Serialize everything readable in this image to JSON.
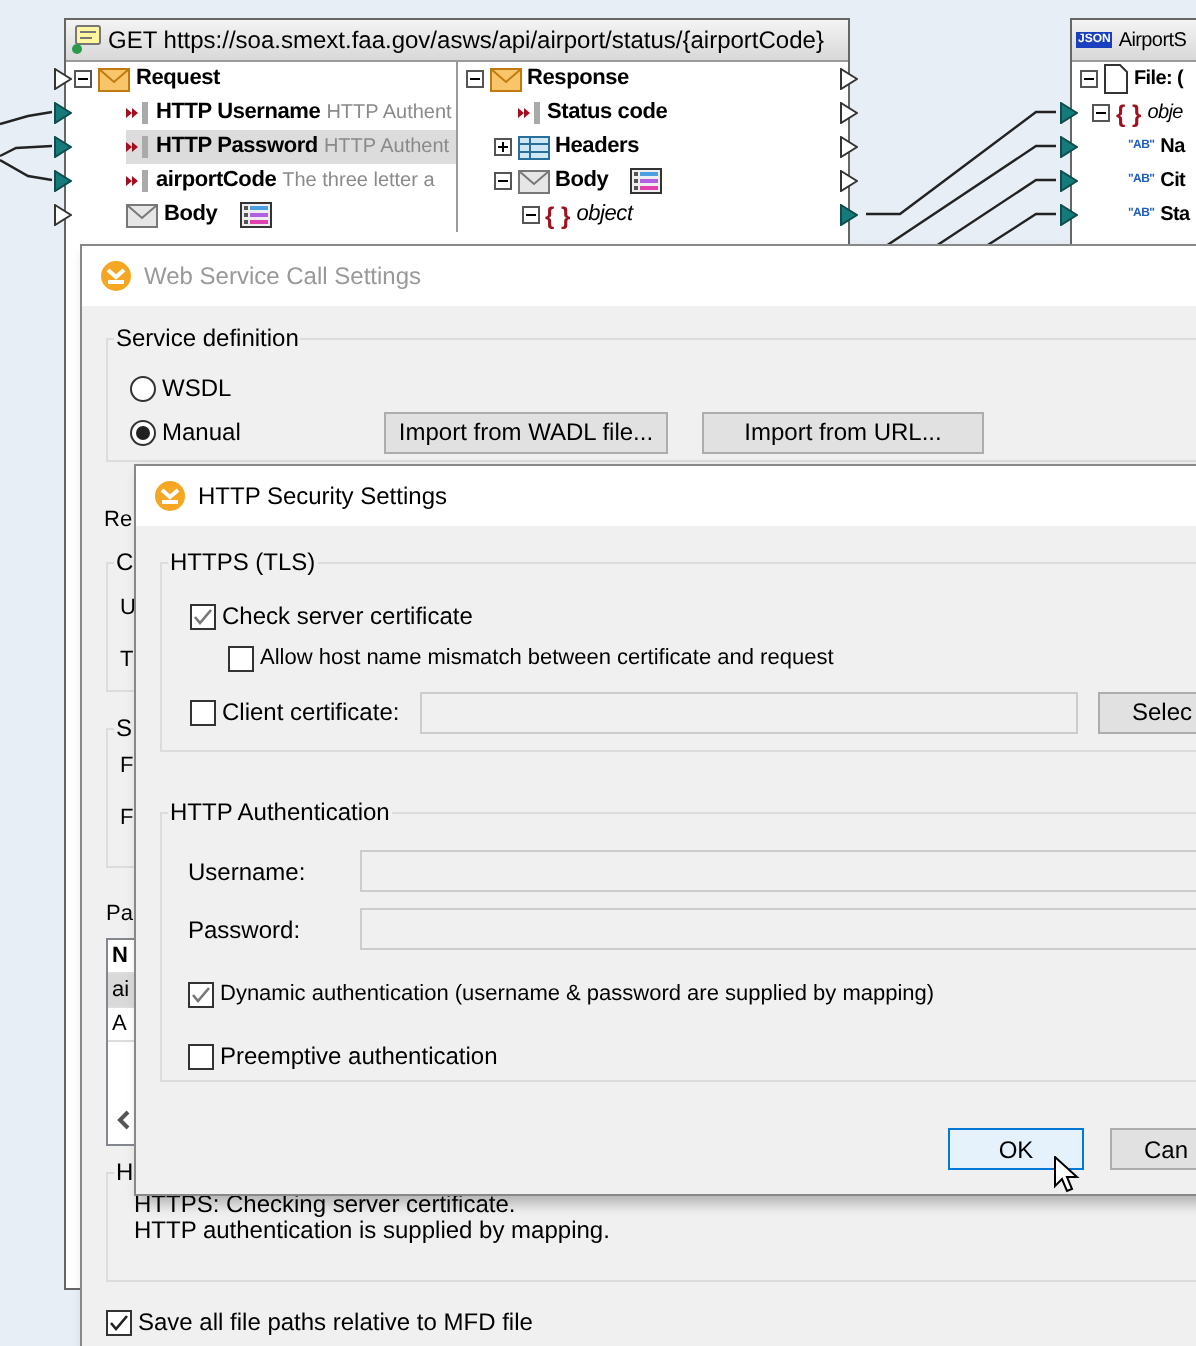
{
  "canvas": {
    "component": {
      "title": "GET https://soa.smext.faa.gov/asws/api/airport/status/{airportCode}",
      "request": [
        {
          "kind": "envelope",
          "label": "Request",
          "expanded": true,
          "connected": false,
          "children": [
            {
              "kind": "parameter",
              "label": "HTTP Username",
              "description": "HTTP Authent",
              "selected": false,
              "connected": true
            },
            {
              "kind": "parameter",
              "label": "HTTP Password",
              "description": "HTTP Authent",
              "selected": true,
              "connected": true
            },
            {
              "kind": "parameter",
              "label": "airportCode",
              "description": "The three letter a",
              "selected": false,
              "connected": true
            },
            {
              "kind": "body",
              "label": "Body",
              "selected": false,
              "connected": false
            }
          ]
        }
      ],
      "response": [
        {
          "kind": "envelope",
          "label": "Response",
          "expanded": true,
          "connected": false,
          "children": [
            {
              "kind": "parameter",
              "label": "Status code",
              "connected": false
            },
            {
              "kind": "table",
              "label": "Headers",
              "expanded": false,
              "connected": false
            },
            {
              "kind": "body",
              "label": "Body",
              "expanded": true,
              "connected": false,
              "children": [
                {
                  "kind": "object",
                  "symbol": "{ }",
                  "label": "object",
                  "expanded": true,
                  "connected": true
                }
              ]
            }
          ]
        }
      ]
    },
    "target": {
      "badge": "JSON",
      "title": "AirportS",
      "tree": [
        {
          "kind": "file",
          "label": "File: (",
          "expanded": true,
          "children": [
            {
              "kind": "object",
              "symbol": "{ }",
              "label": "obje",
              "expanded": true,
              "connected": true,
              "children": [
                {
                  "kind": "string",
                  "symbol": "\"AB\"",
                  "label": "Na",
                  "connected": true
                },
                {
                  "kind": "string",
                  "symbol": "\"AB\"",
                  "label": "Cit",
                  "connected": true
                },
                {
                  "kind": "string",
                  "symbol": "\"AB\"",
                  "label": "Sta",
                  "connected": true
                }
              ]
            }
          ]
        }
      ]
    }
  },
  "web_service_dialog": {
    "title": "Web Service Call Settings",
    "service_definition": {
      "label": "Service definition",
      "options": [
        {
          "label": "WSDL",
          "selected": false
        },
        {
          "label": "Manual",
          "selected": true
        }
      ],
      "buttons": [
        "Import from WADL file...",
        "Import from URL..."
      ]
    },
    "request_label": "Re",
    "group_1": {
      "label": "C",
      "rows": [
        "U",
        "T"
      ]
    },
    "group_2": {
      "label": "S",
      "rows": [
        "F",
        "F"
      ]
    },
    "parameters": {
      "label": "Pa",
      "header": "N",
      "rows": [
        {
          "text": "ai",
          "selected": true
        },
        {
          "text": "A",
          "selected": false
        }
      ]
    },
    "info": {
      "label": "H",
      "lines": [
        "HTTPS: Checking server certificate.",
        "HTTP authentication is supplied by mapping."
      ]
    },
    "save_relative": {
      "label": "Save all file paths relative to MFD file",
      "checked": true
    }
  },
  "security_dialog": {
    "title": "HTTP Security Settings",
    "https": {
      "label": "HTTPS (TLS)",
      "check_server": {
        "label": "Check server certificate",
        "checked": true
      },
      "allow_mismatch": {
        "label": "Allow host name mismatch between certificate and request",
        "checked": false
      },
      "client_certificate": {
        "label": "Client certificate:",
        "checked": false,
        "button": "Selec"
      }
    },
    "auth": {
      "label": "HTTP Authentication",
      "fields": [
        {
          "label": "Username:"
        },
        {
          "label": "Password:"
        }
      ],
      "dynamic": {
        "label": "Dynamic authentication (username & password are supplied by mapping)",
        "checked": true
      },
      "preemptive": {
        "label": "Preemptive authentication",
        "checked": false
      }
    },
    "buttons": [
      {
        "label": "OK",
        "focused": true
      },
      {
        "label": "Can",
        "focused": false
      }
    ]
  }
}
